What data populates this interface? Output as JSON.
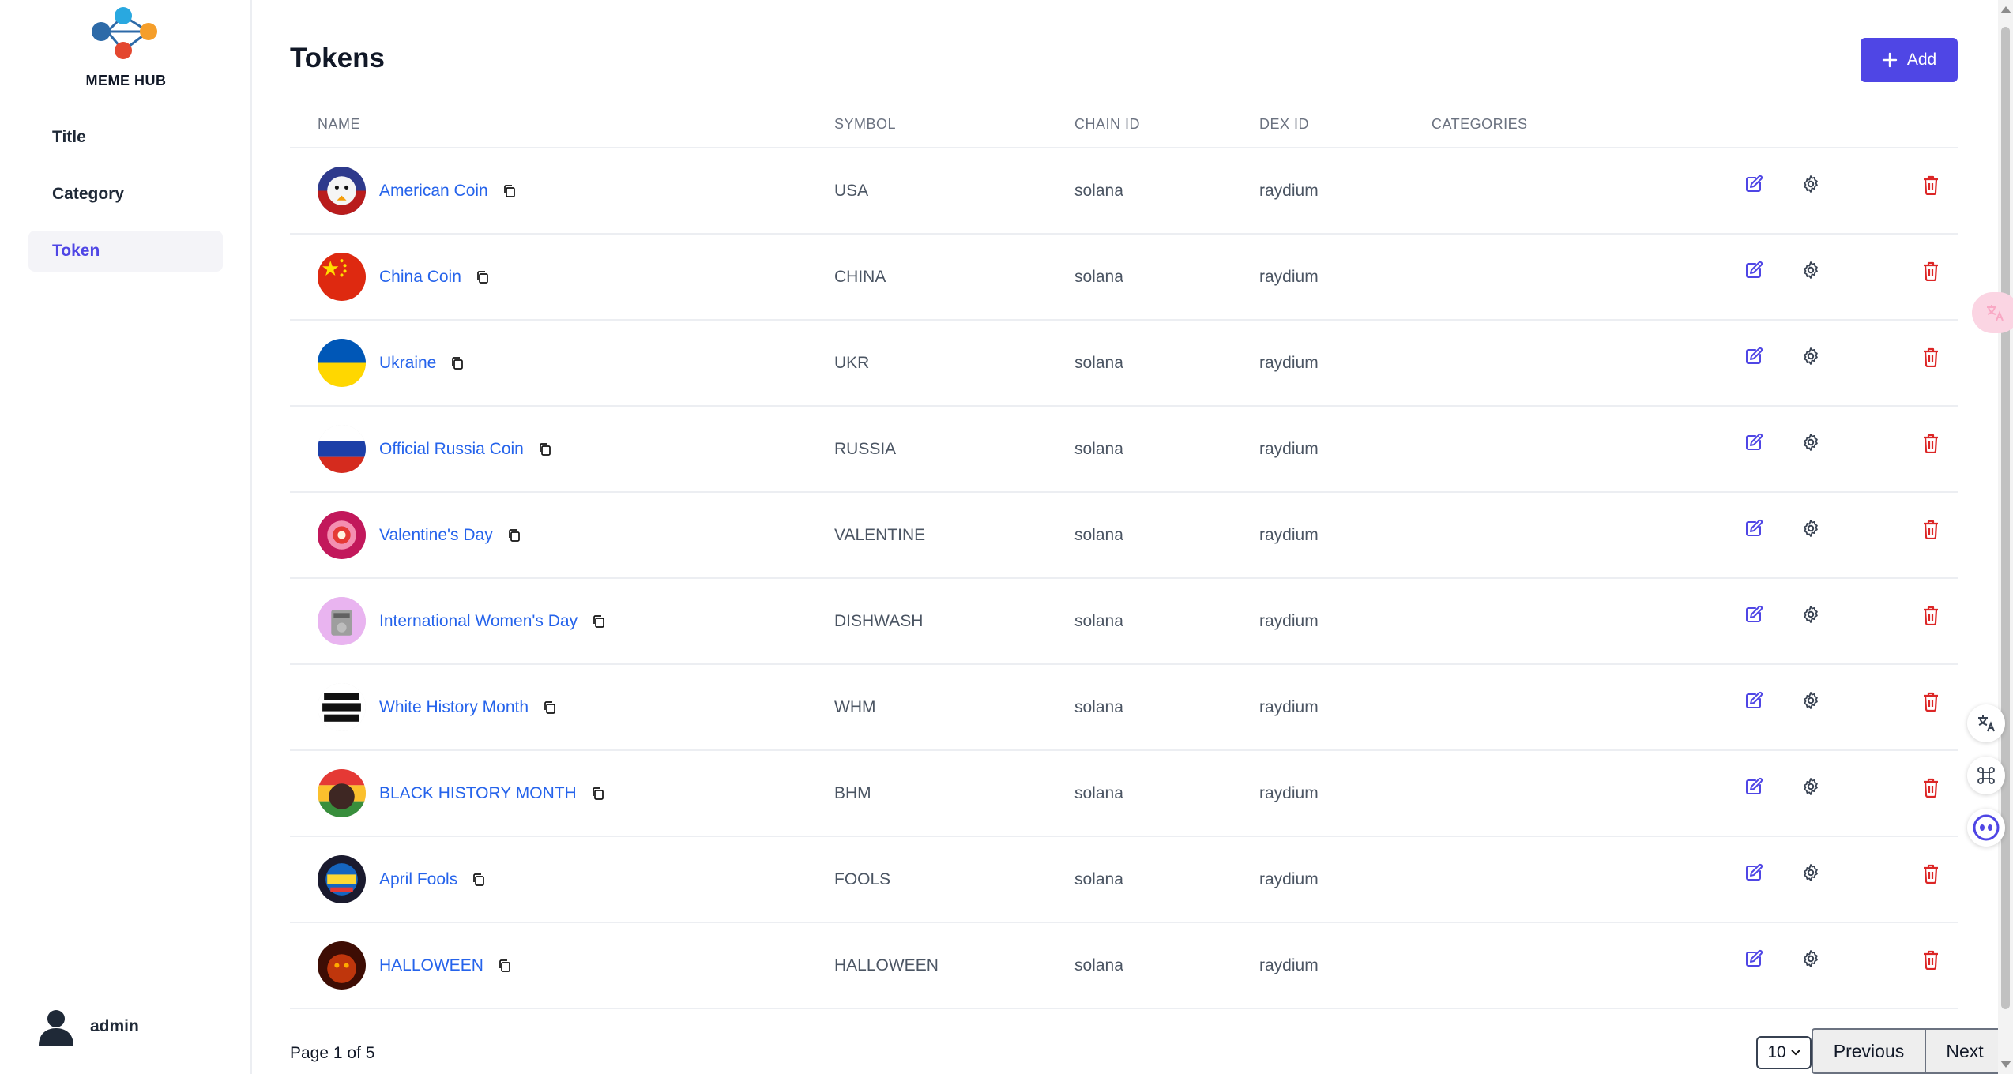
{
  "brand": {
    "name": "MEME HUB"
  },
  "sidebar": {
    "items": [
      {
        "label": "Title",
        "active": false
      },
      {
        "label": "Category",
        "active": false
      },
      {
        "label": "Token",
        "active": true
      }
    ],
    "user": {
      "name": "admin"
    }
  },
  "header": {
    "title": "Tokens",
    "add_label": "Add"
  },
  "table": {
    "columns": {
      "name": "NAME",
      "symbol": "SYMBOL",
      "chain_id": "CHAIN ID",
      "dex_id": "DEX ID",
      "categories": "CATEGORIES"
    },
    "rows": [
      {
        "name": "American Coin",
        "symbol": "USA",
        "chain_id": "solana",
        "dex_id": "raydium",
        "categories": ""
      },
      {
        "name": "China Coin",
        "symbol": "CHINA",
        "chain_id": "solana",
        "dex_id": "raydium",
        "categories": ""
      },
      {
        "name": "Ukraine",
        "symbol": "UKR",
        "chain_id": "solana",
        "dex_id": "raydium",
        "categories": ""
      },
      {
        "name": "Official Russia Coin",
        "symbol": "RUSSIA",
        "chain_id": "solana",
        "dex_id": "raydium",
        "categories": ""
      },
      {
        "name": "Valentine's Day",
        "symbol": "VALENTINE",
        "chain_id": "solana",
        "dex_id": "raydium",
        "categories": ""
      },
      {
        "name": "International Women's Day",
        "symbol": "DISHWASH",
        "chain_id": "solana",
        "dex_id": "raydium",
        "categories": ""
      },
      {
        "name": "White History Month",
        "symbol": "WHM",
        "chain_id": "solana",
        "dex_id": "raydium",
        "categories": ""
      },
      {
        "name": "BLACK HISTORY MONTH",
        "symbol": "BHM",
        "chain_id": "solana",
        "dex_id": "raydium",
        "categories": ""
      },
      {
        "name": "April Fools",
        "symbol": "FOOLS",
        "chain_id": "solana",
        "dex_id": "raydium",
        "categories": ""
      },
      {
        "name": "HALLOWEEN",
        "symbol": "HALLOWEEN",
        "chain_id": "solana",
        "dex_id": "raydium",
        "categories": ""
      }
    ]
  },
  "pagination": {
    "info": "Page 1 of 5",
    "page_size": "10",
    "prev_label": "Previous",
    "next_label": "Next"
  },
  "colors": {
    "accent": "#4f46e5",
    "link": "#2563eb",
    "danger": "#dc2626",
    "muted": "#6b7280"
  },
  "icons": {
    "edit": "edit-icon",
    "settings": "gear-icon",
    "delete": "trash-icon",
    "copy": "copy-icon"
  }
}
